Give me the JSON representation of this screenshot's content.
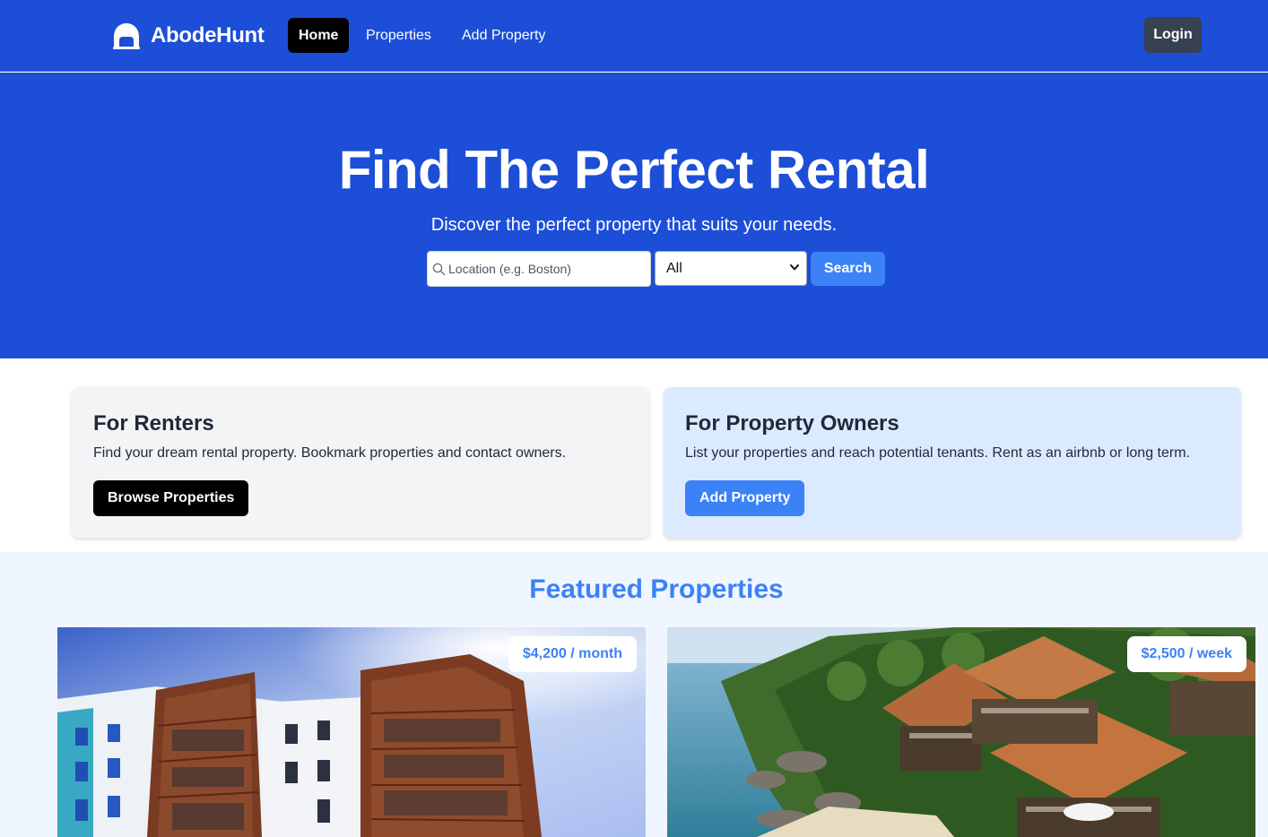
{
  "brand": {
    "name": "AbodeHunt",
    "icon": "house-logo-icon"
  },
  "nav": {
    "links": [
      {
        "label": "Home",
        "active": true
      },
      {
        "label": "Properties",
        "active": false
      },
      {
        "label": "Add Property",
        "active": false
      }
    ],
    "login_label": "Login"
  },
  "hero": {
    "title": "Find The Perfect Rental",
    "subtitle": "Discover the perfect property that suits your needs.",
    "search": {
      "placeholder": "Location (e.g. Boston)",
      "value": "",
      "icon": "search-icon",
      "type_selected": "All",
      "button_label": "Search"
    }
  },
  "cards": {
    "renters": {
      "title": "For Renters",
      "text": "Find your dream rental property. Bookmark properties and contact owners.",
      "button_label": "Browse Properties"
    },
    "owners": {
      "title": "For Property Owners",
      "text": "List your properties and reach potential tenants. Rent as an airbnb or long term.",
      "button_label": "Add Property"
    }
  },
  "featured": {
    "title": "Featured Properties",
    "properties": [
      {
        "price": "$4,200 / month"
      },
      {
        "price": "$2,500 / week"
      }
    ]
  },
  "colors": {
    "primary": "#1d4ed8",
    "accent": "#3b82f6",
    "dark": "#000000",
    "login_bg": "#374151",
    "owners_card_bg": "#dbeafe",
    "renters_card_bg": "#f3f4f6",
    "featured_bg": "#eff6ff"
  }
}
